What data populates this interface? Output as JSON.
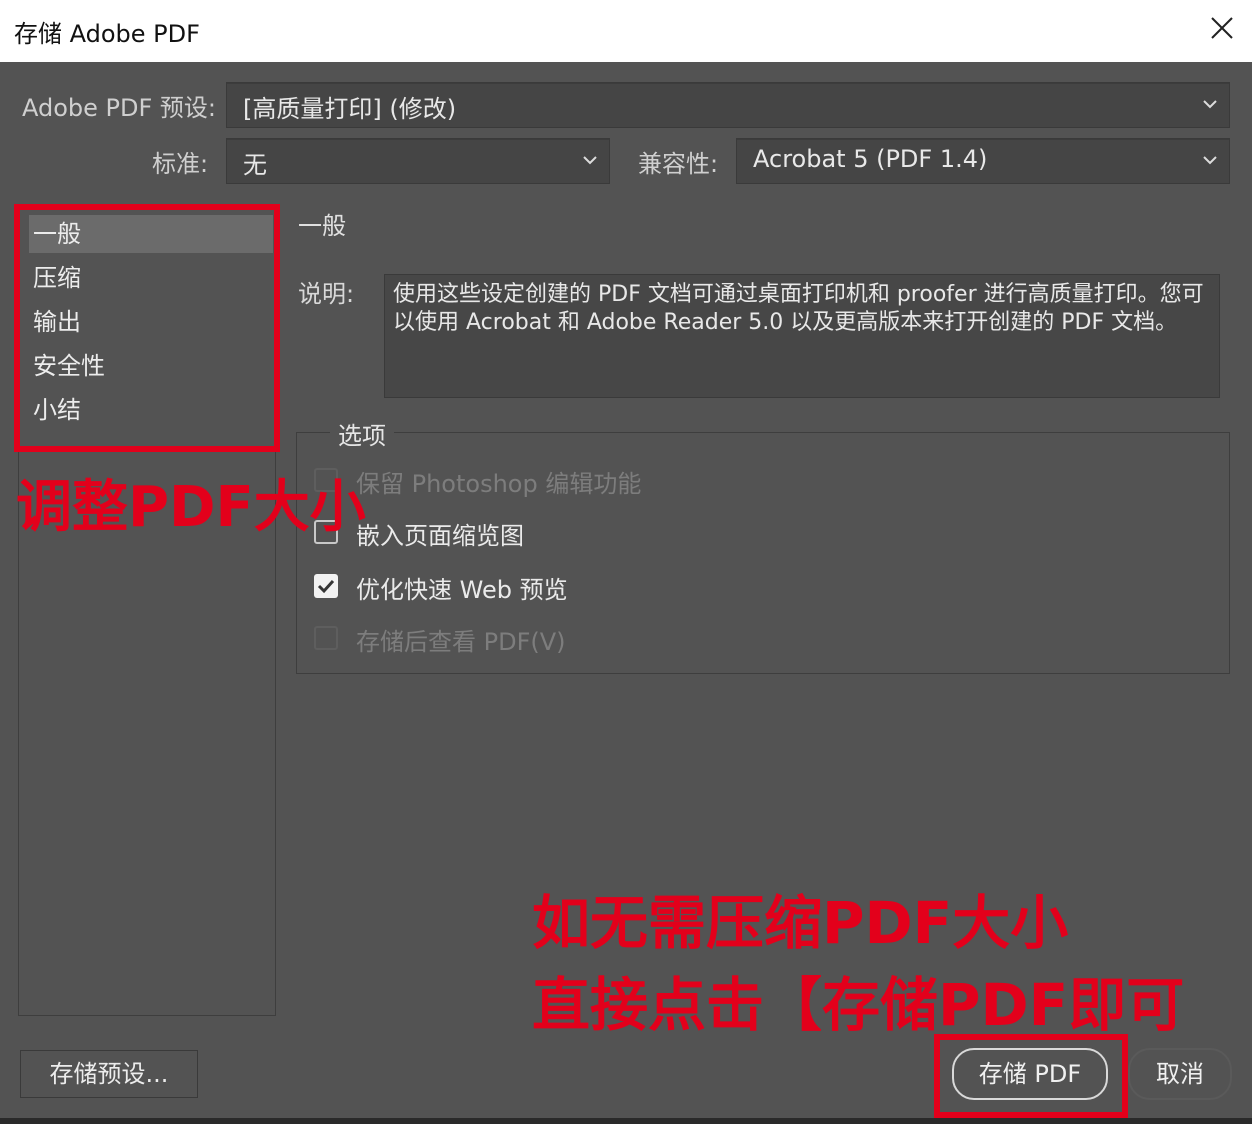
{
  "window": {
    "title": "存储 Adobe PDF"
  },
  "header": {
    "preset_label": "Adobe PDF 预设:",
    "preset_value": "[高质量打印] (修改)",
    "standard_label": "标准:",
    "standard_value": "无",
    "compat_label": "兼容性:",
    "compat_value": "Acrobat 5 (PDF 1.4)"
  },
  "sidebar": {
    "items": [
      {
        "label": "一般",
        "selected": true
      },
      {
        "label": "压缩",
        "selected": false
      },
      {
        "label": "输出",
        "selected": false
      },
      {
        "label": "安全性",
        "selected": false
      },
      {
        "label": "小结",
        "selected": false
      }
    ]
  },
  "main": {
    "section_title": "一般",
    "desc_label": "说明:",
    "description": "使用这些设定创建的 PDF 文档可通过桌面打印机和 proofer 进行高质量打印。您可以使用 Acrobat 和 Adobe Reader 5.0 以及更高版本来打开创建的 PDF 文档。",
    "options_title": "选项",
    "options": [
      {
        "label": "保留 Photoshop 编辑功能",
        "checked": false,
        "enabled": false
      },
      {
        "label": "嵌入页面缩览图",
        "checked": false,
        "enabled": true
      },
      {
        "label": "优化快速 Web 预览",
        "checked": true,
        "enabled": true
      },
      {
        "label": "存储后查看 PDF(V)",
        "checked": false,
        "enabled": false
      }
    ]
  },
  "footer": {
    "save_preset_label": "存储预设...",
    "save_pdf_label": "存储 PDF",
    "cancel_label": "取消"
  },
  "annotations": {
    "left_note": "调整PDF大小",
    "bottom_note_line1": "如无需压缩PDF大小",
    "bottom_note_line2": "直接点击【存储PDF即可",
    "color": "#e3001b"
  },
  "colors": {
    "dialog_bg": "#535353",
    "field_bg": "#454545",
    "selected_item": "#6b6b6b",
    "annotation_red": "#e3001b"
  }
}
